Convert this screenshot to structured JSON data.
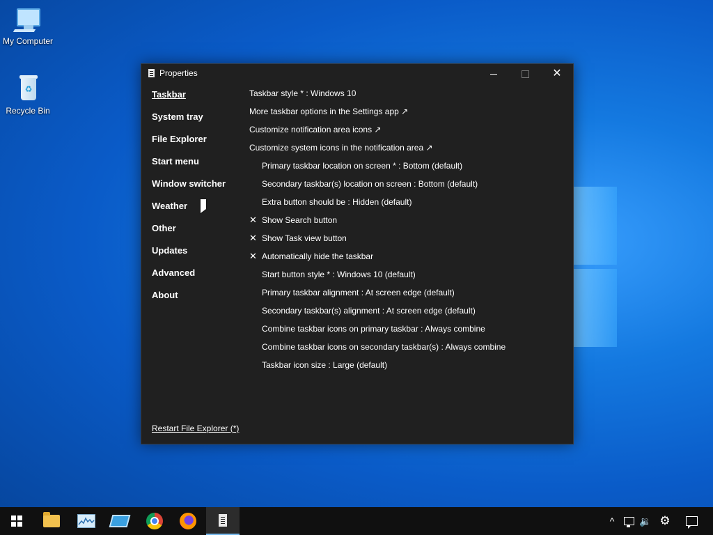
{
  "desktop": {
    "icons": [
      {
        "label": "My Computer"
      },
      {
        "label": "Recycle Bin"
      }
    ]
  },
  "window": {
    "title": "Properties",
    "close_glyph": "✕"
  },
  "sidebar": {
    "items": [
      {
        "label": "Taskbar",
        "active": true
      },
      {
        "label": "System tray"
      },
      {
        "label": "File Explorer"
      },
      {
        "label": "Start menu"
      },
      {
        "label": "Window switcher"
      },
      {
        "label": "Weather"
      },
      {
        "label": "Other"
      },
      {
        "label": "Updates"
      },
      {
        "label": "Advanced"
      },
      {
        "label": "About"
      }
    ],
    "restart_link": "Restart File Explorer (*)"
  },
  "settings": {
    "rows": [
      {
        "text": "Taskbar style * : Windows 10"
      },
      {
        "text": "More taskbar options in the Settings app ↗"
      },
      {
        "text": "Customize notification area icons ↗"
      },
      {
        "text": "Customize system icons in the notification area ↗"
      },
      {
        "text": "Primary taskbar location on screen * : Bottom (default)"
      },
      {
        "text": "Secondary taskbar(s) location on screen : Bottom (default)"
      },
      {
        "text": "Extra button should be : Hidden (default)"
      },
      {
        "text": "Show Search button",
        "check": "✕"
      },
      {
        "text": "Show Task view button",
        "check": "✕"
      },
      {
        "text": "Automatically hide the taskbar",
        "check": "✕"
      },
      {
        "text": "Start button style * : Windows 10 (default)"
      },
      {
        "text": "Primary taskbar alignment : At screen edge (default)"
      },
      {
        "text": "Secondary taskbar(s) alignment : At screen edge (default)"
      },
      {
        "text": "Combine taskbar icons on primary taskbar : Always combine"
      },
      {
        "text": "Combine taskbar icons on secondary taskbar(s) : Always combine"
      },
      {
        "text": "Taskbar icon size : Large (default)"
      }
    ]
  },
  "taskbar": {
    "apps": [
      "start-icon",
      "file-explorer-icon",
      "performance-monitor-icon",
      "tile-app-icon",
      "chrome-icon",
      "firefox-icon",
      "properties-app-icon"
    ],
    "tray": {
      "chevron": "^",
      "volume": "🔉",
      "gear": "⚙"
    }
  },
  "colors": {
    "window_bg": "#202020",
    "taskbar_bg": "#101010",
    "accent": "#76b9ed"
  }
}
